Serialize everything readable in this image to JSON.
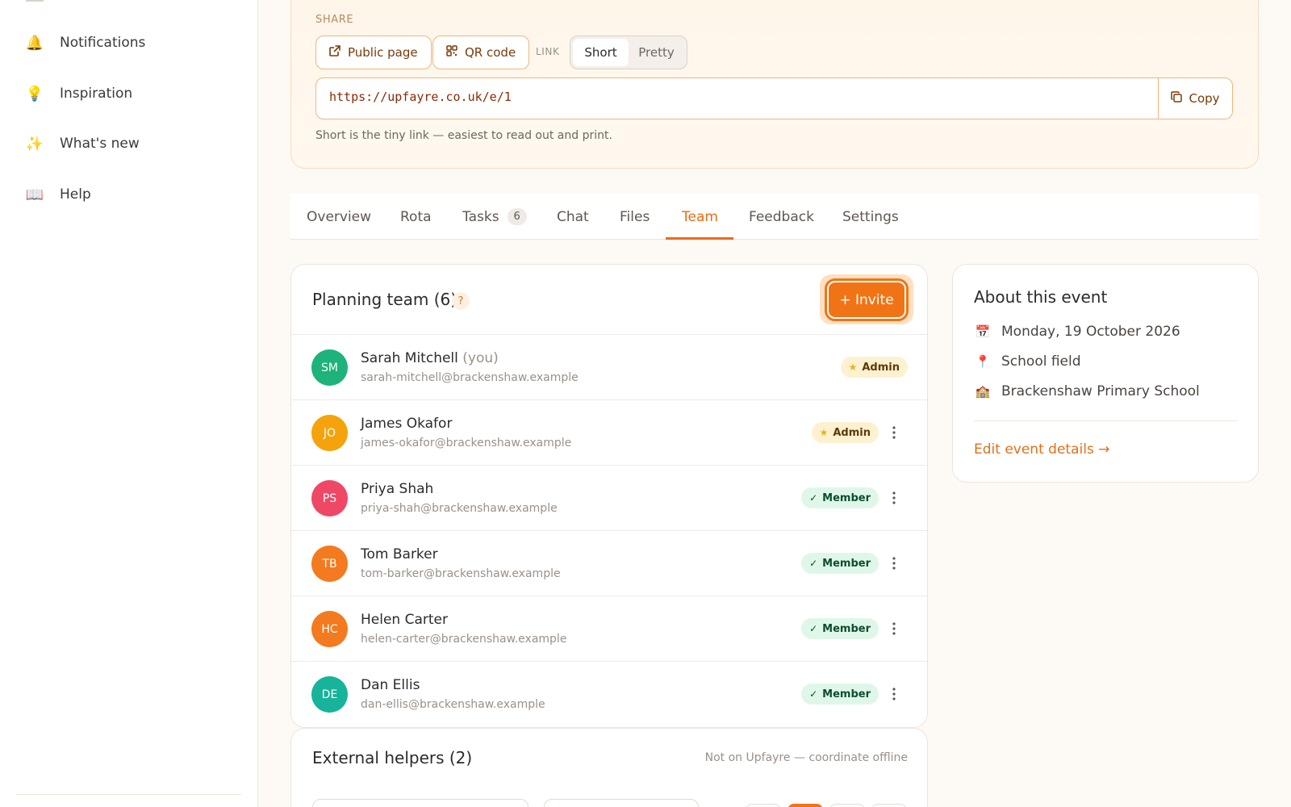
{
  "sidebar": {
    "items": [
      {
        "icon": "bell-icon",
        "glyph": "🔔",
        "label": "Notifications"
      },
      {
        "icon": "lightbulb-icon",
        "glyph": "💡",
        "label": "Inspiration"
      },
      {
        "icon": "sparkles-icon",
        "glyph": "✨",
        "label": "What's new"
      },
      {
        "icon": "book-icon",
        "glyph": "📖",
        "label": "Help"
      }
    ]
  },
  "share": {
    "title": "SHARE",
    "public_page": "Public page",
    "qr_code": "QR code",
    "link_label": "LINK",
    "link_options": [
      "Short",
      "Pretty"
    ],
    "selected_link_option": "Short",
    "url": "https://upfayre.co.uk/e/1",
    "copy": "Copy",
    "hint": "Short is the tiny link — easiest to read out and print."
  },
  "tabs": [
    {
      "label": "Overview"
    },
    {
      "label": "Rota"
    },
    {
      "label": "Tasks",
      "badge": "6"
    },
    {
      "label": "Chat"
    },
    {
      "label": "Files"
    },
    {
      "label": "Team"
    },
    {
      "label": "Feedback"
    },
    {
      "label": "Settings"
    }
  ],
  "active_tab": "Team",
  "team": {
    "title": "Planning team (6)",
    "help": "?",
    "invite": "+ Invite",
    "members": [
      {
        "initials": "SM",
        "color": "#1db37a",
        "name": "Sarah Mitchell",
        "suffix": "(you)",
        "email": "sarah-mitchell@brackenshaw.example",
        "role": "Admin",
        "role_icon": "★",
        "has_menu": false
      },
      {
        "initials": "JO",
        "color": "#f4a30c",
        "name": "James Okafor",
        "suffix": "",
        "email": "james-okafor@brackenshaw.example",
        "role": "Admin",
        "role_icon": "★",
        "has_menu": true
      },
      {
        "initials": "PS",
        "color": "#ef4866",
        "name": "Priya Shah",
        "suffix": "",
        "email": "priya-shah@brackenshaw.example",
        "role": "Member",
        "role_icon": "✓",
        "has_menu": true
      },
      {
        "initials": "TB",
        "color": "#f37a1e",
        "name": "Tom Barker",
        "suffix": "",
        "email": "tom-barker@brackenshaw.example",
        "role": "Member",
        "role_icon": "✓",
        "has_menu": true
      },
      {
        "initials": "HC",
        "color": "#f37a1e",
        "name": "Helen Carter",
        "suffix": "",
        "email": "helen-carter@brackenshaw.example",
        "role": "Member",
        "role_icon": "✓",
        "has_menu": true
      },
      {
        "initials": "DE",
        "color": "#17b39b",
        "name": "Dan Ellis",
        "suffix": "",
        "email": "dan-ellis@brackenshaw.example",
        "role": "Member",
        "role_icon": "✓",
        "has_menu": true
      }
    ]
  },
  "external": {
    "title": "External helpers (2)",
    "note": "Not on Upfayre — coordinate offline"
  },
  "about": {
    "title": "About this event",
    "rows": [
      {
        "icon": "calendar-icon",
        "glyph": "📅",
        "text": "Monday, 19 October 2026"
      },
      {
        "icon": "pin-icon",
        "glyph": "📍",
        "text": "School field"
      },
      {
        "icon": "school-icon",
        "glyph": "🏫",
        "text": "Brackenshaw Primary School"
      }
    ],
    "edit": "Edit event details →"
  },
  "colors": {
    "accent": "#f07415",
    "admin_badge": "#fdf1d0",
    "member_badge": "#dff7e9"
  }
}
